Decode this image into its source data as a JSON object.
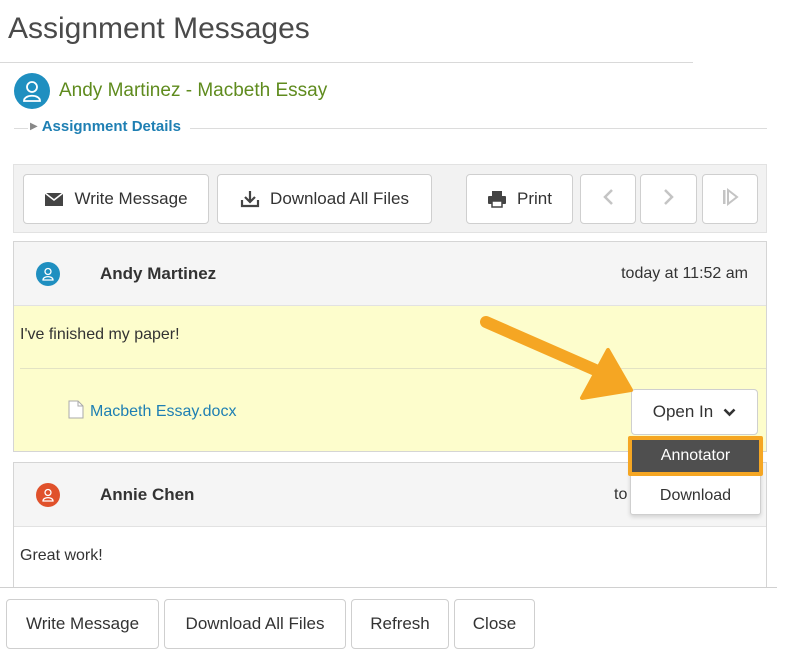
{
  "page": {
    "title": "Assignment Messages"
  },
  "header": {
    "title": "Andy Martinez - Macbeth Essay",
    "details_label": "Assignment Details"
  },
  "toolbar": {
    "write_message": "Write Message",
    "download_all": "Download All Files",
    "print": "Print"
  },
  "messages": [
    {
      "author": "Andy Martinez",
      "time": "today at 11:52 am",
      "text": "I've finished my paper!",
      "attachment": "Macbeth Essay.docx",
      "avatar_color": "#1f8fc0"
    },
    {
      "author": "Annie Chen",
      "time": "to",
      "text": "Great work!",
      "avatar_color": "#e0512b"
    }
  ],
  "open_in": {
    "label": "Open In",
    "options": [
      "Annotator",
      "Download"
    ],
    "highlighted": "Annotator"
  },
  "footer": {
    "write_message": "Write Message",
    "download_all": "Download All Files",
    "refresh": "Refresh",
    "close": "Close"
  },
  "colors": {
    "accent_link": "#1e7fb3",
    "header_green": "#5f8b1e",
    "highlight_orange": "#f5a623",
    "message_yellow": "#fdfdcc"
  }
}
